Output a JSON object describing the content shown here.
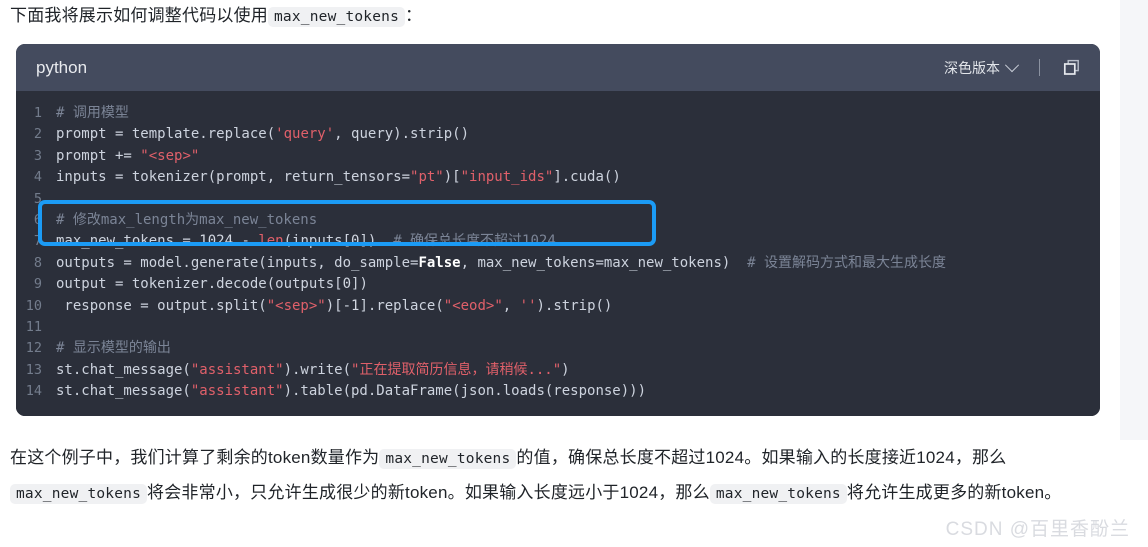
{
  "intro": {
    "before": "下面我将展示如何调整代码以使用",
    "code": "max_new_tokens",
    "after": "："
  },
  "code_block": {
    "language": "python",
    "theme_label": "深色版本",
    "chevron_icon": "chevron-down-icon",
    "copy_icon": "copy-icon",
    "lines": [
      {
        "n": "1",
        "text": "# 调用模型"
      },
      {
        "n": "2",
        "text": "prompt = template.replace('query', query).strip()"
      },
      {
        "n": "3",
        "text": "prompt += \"<sep>\""
      },
      {
        "n": "4",
        "text": "inputs = tokenizer(prompt, return_tensors=\"pt\")[\"input_ids\"].cuda()"
      },
      {
        "n": "5",
        "text": ""
      },
      {
        "n": "6",
        "text": "# 修改max_length为max_new_tokens"
      },
      {
        "n": "7",
        "text": "max_new_tokens = 1024 - len(inputs[0])  # 确保总长度不超过1024"
      },
      {
        "n": "8",
        "text": "outputs = model.generate(inputs, do_sample=False, max_new_tokens=max_new_tokens)  # 设置解码方式和最大生成长度"
      },
      {
        "n": "9",
        "text": "output = tokenizer.decode(outputs[0])"
      },
      {
        "n": "10",
        "text": " response = output.split(\"<sep>\")[-1].replace(\"<eod>\", '').strip()"
      },
      {
        "n": "11",
        "text": ""
      },
      {
        "n": "12",
        "text": "# 显示模型的输出"
      },
      {
        "n": "13",
        "text": "st.chat_message(\"assistant\").write(\"正在提取简历信息，请稍候...\")"
      },
      {
        "n": "14",
        "text": "st.chat_message(\"assistant\").table(pd.DataFrame(json.loads(response)))"
      }
    ],
    "highlight": {
      "from_line": "6",
      "to_line": "7",
      "color": "#1b9bf5"
    }
  },
  "outro": {
    "p1": "在这个例子中，我们计算了剩余的token数量作为",
    "c1": "max_new_tokens",
    "p2": "的值，确保总长度不超过1024。如果输入的长度接近1024，那么",
    "c2": "max_new_tokens",
    "p3": "将会非常小，只允许生成很少的新token。如果输入长度远小于1024，那么",
    "c3": "max_new_tokens",
    "p4": "将允许生成更多的新token。"
  },
  "watermark": "CSDN @百里香酚兰",
  "colors": {
    "code_bg": "#2b2f3a",
    "header_bg": "#444b5e",
    "string": "#e0606a",
    "comment": "#7b8496",
    "highlight": "#1b9bf5"
  }
}
